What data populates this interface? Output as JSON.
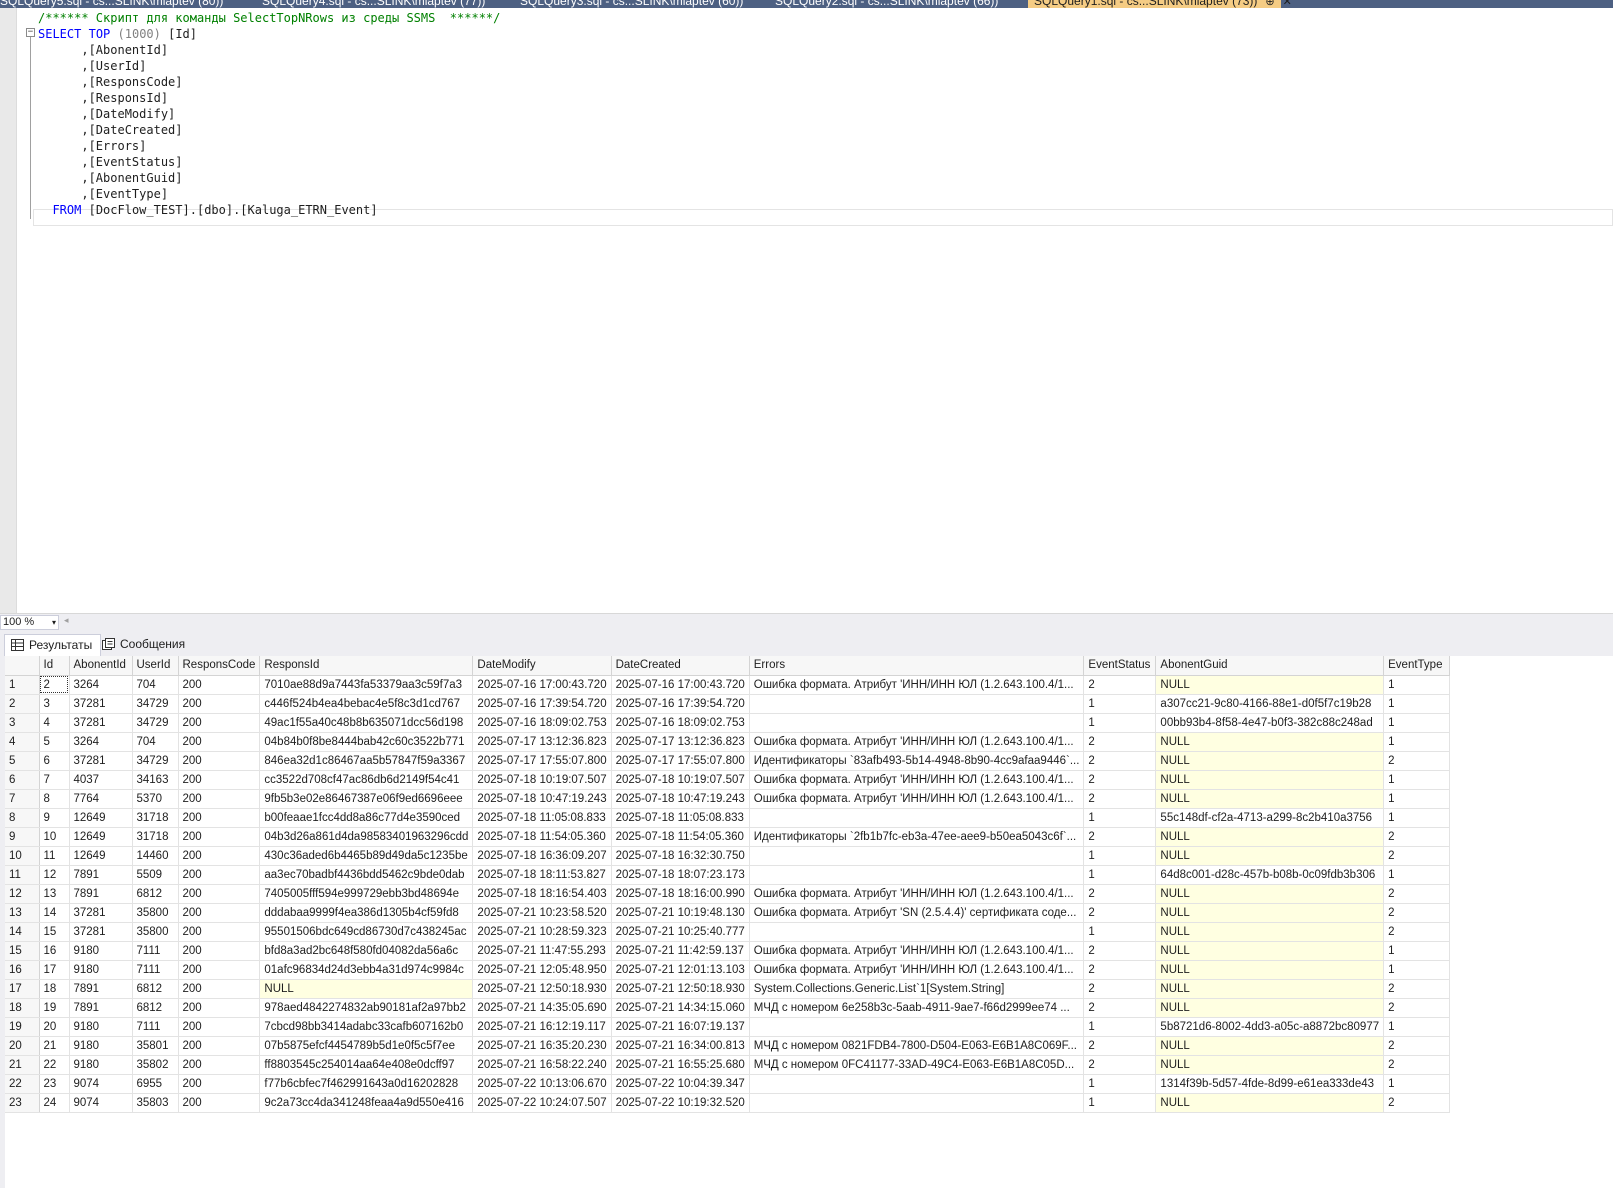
{
  "doc_tabs": [
    {
      "label": "SQLQuery5.sql - cs...SLINK\\mlaptev (80))",
      "active": false
    },
    {
      "label": "SQLQuery4.sql - cs...SLINK\\mlaptev (77))",
      "active": false
    },
    {
      "label": "SQLQuery3.sql - cs...SLINK\\mlaptev (60))",
      "active": false
    },
    {
      "label": "SQLQuery2.sql - cs...SLINK\\mlaptev (66))",
      "active": false
    },
    {
      "label": "SQLQuery1.sql - cs...SLINK\\mlaptev (73))",
      "active": true,
      "pin": "⊕",
      "close": "✕"
    }
  ],
  "editor": {
    "comment": "/****** Скрипт для команды SelectTopNRows из среды SSMS  ******/",
    "select_kw": "SELECT",
    "top_kw": "TOP",
    "top_value": "(1000)",
    "first_column": "[Id]",
    "columns": [
      ",[AbonentId]",
      ",[UserId]",
      ",[ResponsCode]",
      ",[ResponsId]",
      ",[DateModify]",
      ",[DateCreated]",
      ",[Errors]",
      ",[EventStatus]",
      ",[AbonentGuid]",
      ",[EventType]"
    ],
    "from_kw": "FROM",
    "from_table": "[DocFlow_TEST].[dbo].[Kaluga_ETRN_Event]",
    "collapse_glyph": "−"
  },
  "zoom": {
    "value": "100 %",
    "arrow": "▾",
    "scroll_left": "◂"
  },
  "results_tabs": [
    {
      "label": "Результаты",
      "active": true
    },
    {
      "label": "Сообщения",
      "active": false
    }
  ],
  "grid": {
    "columns": [
      "Id",
      "AbonentId",
      "UserId",
      "ResponsCode",
      "ResponsId",
      "DateModify",
      "DateCreated",
      "Errors",
      "EventStatus",
      "AbonentGuid",
      "EventType"
    ],
    "rows": [
      [
        "1",
        "2",
        "3264",
        "704",
        "200",
        "7010ae88d9a7443fa53379aa3c59f7a3",
        "2025-07-16 17:00:43.720",
        "2025-07-16 17:00:43.720",
        "Ошибка формата. Атрибут 'ИНН/ИНН ЮЛ (1.2.643.100.4/1...",
        "2",
        "NULL",
        "1"
      ],
      [
        "2",
        "3",
        "37281",
        "34729",
        "200",
        "c446f524b4ea4bebac4e5f8c3d1cd767",
        "2025-07-16 17:39:54.720",
        "2025-07-16 17:39:54.720",
        "",
        "1",
        "a307cc21-9c80-4166-88e1-d0f5f7c19b28",
        "1"
      ],
      [
        "3",
        "4",
        "37281",
        "34729",
        "200",
        "49ac1f55a40c48b8b635071dcc56d198",
        "2025-07-16 18:09:02.753",
        "2025-07-16 18:09:02.753",
        "",
        "1",
        "00bb93b4-8f58-4e47-b0f3-382c88c248ad",
        "1"
      ],
      [
        "4",
        "5",
        "3264",
        "704",
        "200",
        "04b84b0f8be8444bab42c60c3522b771",
        "2025-07-17 13:12:36.823",
        "2025-07-17 13:12:36.823",
        "Ошибка формата. Атрибут 'ИНН/ИНН ЮЛ (1.2.643.100.4/1...",
        "2",
        "NULL",
        "1"
      ],
      [
        "5",
        "6",
        "37281",
        "34729",
        "200",
        "846ea32d1c86467aa5b57847f59a3367",
        "2025-07-17 17:55:07.800",
        "2025-07-17 17:55:07.800",
        "Идентификаторы `83afb493-5b14-4948-8b90-4cc9afaa9446`...",
        "2",
        "NULL",
        "2"
      ],
      [
        "6",
        "7",
        "4037",
        "34163",
        "200",
        "cc3522d708cf47ac86db6d2149f54c41",
        "2025-07-18 10:19:07.507",
        "2025-07-18 10:19:07.507",
        "Ошибка формата. Атрибут 'ИНН/ИНН ЮЛ (1.2.643.100.4/1...",
        "2",
        "NULL",
        "1"
      ],
      [
        "7",
        "8",
        "7764",
        "5370",
        "200",
        "9fb5b3e02e86467387e06f9ed6696eee",
        "2025-07-18 10:47:19.243",
        "2025-07-18 10:47:19.243",
        "Ошибка формата. Атрибут 'ИНН/ИНН ЮЛ (1.2.643.100.4/1...",
        "2",
        "NULL",
        "1"
      ],
      [
        "8",
        "9",
        "12649",
        "31718",
        "200",
        "b00feaae1fcc4dd8a86c77d4e3590ced",
        "2025-07-18 11:05:08.833",
        "2025-07-18 11:05:08.833",
        "",
        "1",
        "55c148df-cf2a-4713-a299-8c2b410a3756",
        "1"
      ],
      [
        "9",
        "10",
        "12649",
        "31718",
        "200",
        "04b3d26a861d4da98583401963296cdd",
        "2025-07-18 11:54:05.360",
        "2025-07-18 11:54:05.360",
        "Идентификаторы `2fb1b7fc-eb3a-47ee-aee9-b50ea5043c6f`...",
        "2",
        "NULL",
        "2"
      ],
      [
        "10",
        "11",
        "12649",
        "14460",
        "200",
        "430c36aded6b4465b89d49da5c1235be",
        "2025-07-18 16:36:09.207",
        "2025-07-18 16:32:30.750",
        "",
        "1",
        "NULL",
        "2"
      ],
      [
        "11",
        "12",
        "7891",
        "5509",
        "200",
        "aa3ec70badbf4436bdd5462c9bde0dab",
        "2025-07-18 18:11:53.827",
        "2025-07-18 18:07:23.173",
        "",
        "1",
        "64d8c001-d28c-457b-b08b-0c09fdb3b306",
        "1"
      ],
      [
        "12",
        "13",
        "7891",
        "6812",
        "200",
        "7405005fff594e999729ebb3bd48694e",
        "2025-07-18 18:16:54.403",
        "2025-07-18 18:16:00.990",
        "Ошибка формата. Атрибут 'ИНН/ИНН ЮЛ (1.2.643.100.4/1...",
        "2",
        "NULL",
        "2"
      ],
      [
        "13",
        "14",
        "37281",
        "35800",
        "200",
        "dddabaa9999f4ea386d1305b4cf59fd8",
        "2025-07-21 10:23:58.520",
        "2025-07-21 10:19:48.130",
        "Ошибка формата. Атрибут 'SN (2.5.4.4)' сертификата соде...",
        "2",
        "NULL",
        "2"
      ],
      [
        "14",
        "15",
        "37281",
        "35800",
        "200",
        "95501506bdc649cd86730d7c438245ac",
        "2025-07-21 10:28:59.323",
        "2025-07-21 10:25:40.777",
        "",
        "1",
        "NULL",
        "2"
      ],
      [
        "15",
        "16",
        "9180",
        "7111",
        "200",
        "bfd8a3ad2bc648f580fd04082da56a6c",
        "2025-07-21 11:47:55.293",
        "2025-07-21 11:42:59.137",
        "Ошибка формата. Атрибут 'ИНН/ИНН ЮЛ (1.2.643.100.4/1...",
        "2",
        "NULL",
        "1"
      ],
      [
        "16",
        "17",
        "9180",
        "7111",
        "200",
        "01afc96834d24d3ebb4a31d974c9984c",
        "2025-07-21 12:05:48.950",
        "2025-07-21 12:01:13.103",
        "Ошибка формата. Атрибут 'ИНН/ИНН ЮЛ (1.2.643.100.4/1...",
        "2",
        "NULL",
        "1"
      ],
      [
        "17",
        "18",
        "7891",
        "6812",
        "200",
        "NULL",
        "2025-07-21 12:50:18.930",
        "2025-07-21 12:50:18.930",
        "System.Collections.Generic.List`1[System.String]",
        "2",
        "NULL",
        "2"
      ],
      [
        "18",
        "19",
        "7891",
        "6812",
        "200",
        "978aed4842274832ab90181af2a97bb2",
        "2025-07-21 14:35:05.690",
        "2025-07-21 14:34:15.060",
        "МЧД с номером 6e258b3c-5aab-4911-9ae7-f66d2999ee74 ...",
        "2",
        "NULL",
        "2"
      ],
      [
        "19",
        "20",
        "9180",
        "7111",
        "200",
        "7cbcd98bb3414adabc33cafb607162b0",
        "2025-07-21 16:12:19.117",
        "2025-07-21 16:07:19.137",
        "",
        "1",
        "5b8721d6-8002-4dd3-a05c-a8872bc80977",
        "1"
      ],
      [
        "20",
        "21",
        "9180",
        "35801",
        "200",
        "07b5875efcf4454789b5d1e0f5c5f7ee",
        "2025-07-21 16:35:20.230",
        "2025-07-21 16:34:00.813",
        "МЧД с номером 0821FDB4-7800-D504-E063-E6B1A8C069F...",
        "2",
        "NULL",
        "2"
      ],
      [
        "21",
        "22",
        "9180",
        "35802",
        "200",
        "ff8803545c254014aa64e408e0dcff97",
        "2025-07-21 16:58:22.240",
        "2025-07-21 16:55:25.680",
        "МЧД с номером 0FC41177-33AD-49C4-E063-E6B1A8C05D...",
        "2",
        "NULL",
        "2"
      ],
      [
        "22",
        "23",
        "9074",
        "6955",
        "200",
        "f77b6cbfec7f462991643a0d16202828",
        "2025-07-22 10:13:06.670",
        "2025-07-22 10:04:39.347",
        "",
        "1",
        "1314f39b-5d57-4fde-8d99-e61ea333de43",
        "1"
      ],
      [
        "23",
        "24",
        "9074",
        "35803",
        "200",
        "9c2a73cc4da341248feaa4a9d550e416",
        "2025-07-22 10:24:07.507",
        "2025-07-22 10:19:32.520",
        "",
        "1",
        "NULL",
        "2"
      ]
    ]
  },
  "colors": {
    "tabstrip": "#4d6082",
    "active_tab": "#f5cc84",
    "null_cell": "#ffffe1",
    "keyword": "#0000ff",
    "comment": "#008000"
  }
}
